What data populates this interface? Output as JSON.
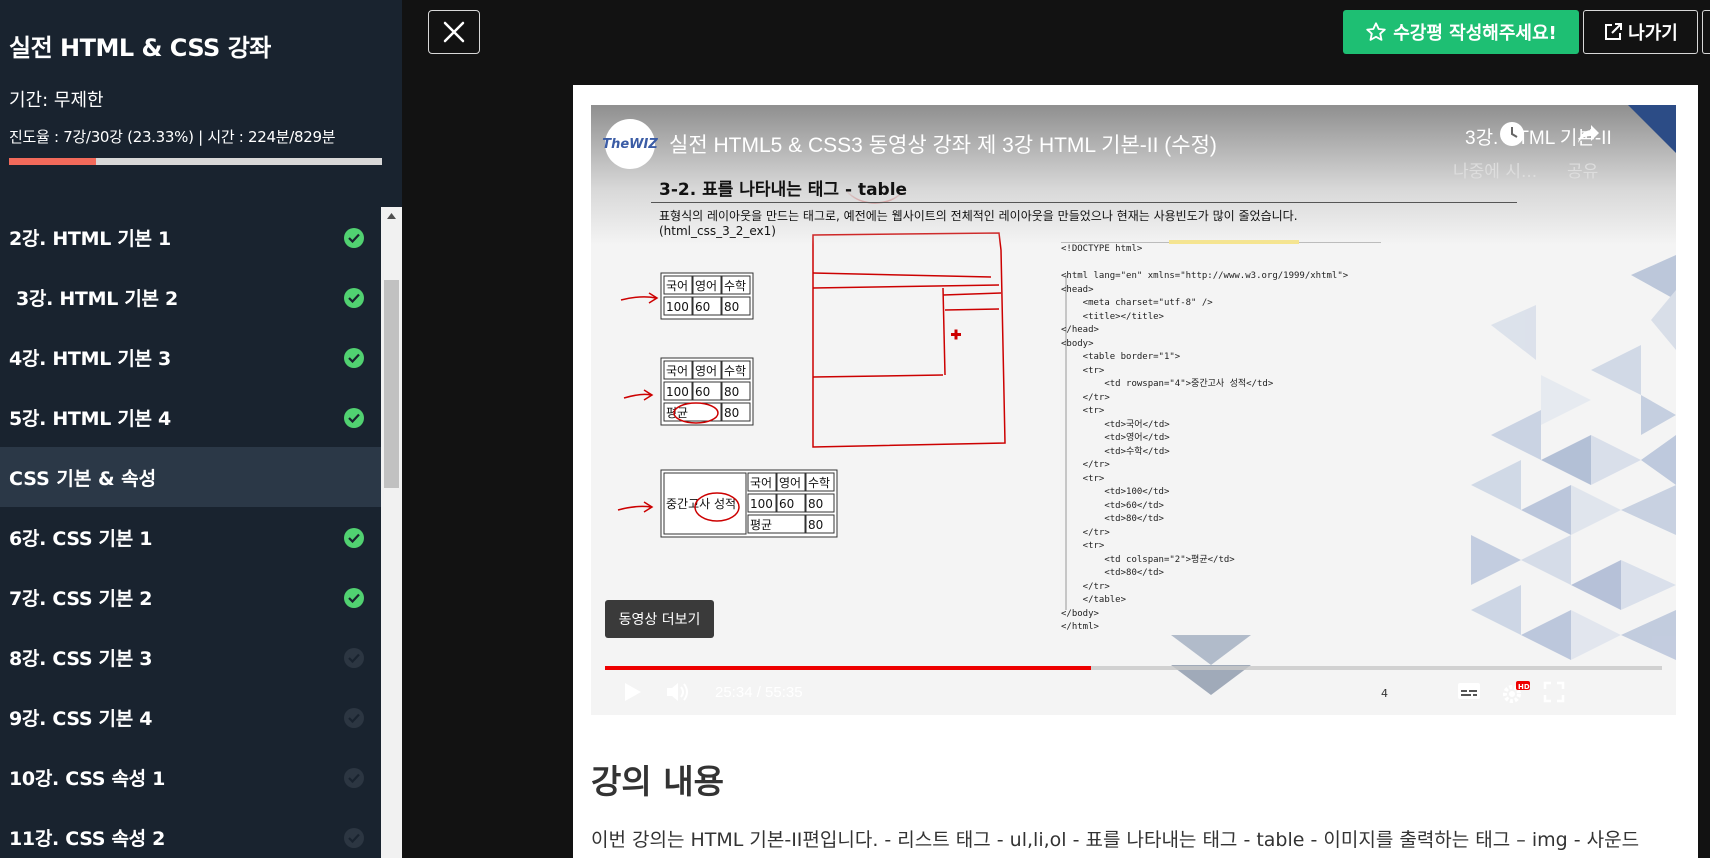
{
  "colors": {
    "sidebar_bg": "#19232f",
    "accent_green": "#1ebf73",
    "progress_fill": "#f26a5b",
    "check_done": "#51d171",
    "video_progress": "#e00000"
  },
  "sidebar": {
    "course_title": "실전 HTML & CSS 강좌",
    "period": "기간: 무제한",
    "progress_text": "진도율 : 7강/30강 (23.33%) | 시간 : 224분/829분",
    "progress_percent": 23.33,
    "items": [
      {
        "label": "2강. HTML 기본 1",
        "status": "done"
      },
      {
        "label": "3강. HTML 기본 2",
        "status": "done"
      },
      {
        "label": "4강. HTML 기본 3",
        "status": "done"
      },
      {
        "label": "5강. HTML 기본 4",
        "status": "done"
      },
      {
        "label": "CSS 기본 & 속성"
      },
      {
        "label": "6강. CSS 기본 1",
        "status": "done"
      },
      {
        "label": "7강. CSS 기본 2",
        "status": "done"
      },
      {
        "label": "8강. CSS 기본 3",
        "status": "todo"
      },
      {
        "label": "9강. CSS 기본 4",
        "status": "todo"
      },
      {
        "label": "10강. CSS 속성 1",
        "status": "todo"
      },
      {
        "label": "11강. CSS 속성 2",
        "status": "todo"
      }
    ]
  },
  "topbar": {
    "close_icon": "close-icon",
    "review_label": "수강평 작성해주세요!",
    "exit_label": "나가기"
  },
  "video": {
    "channel_logo": "TheWIZ",
    "title": "실전 HTML5 & CSS3 동영상 강좌 제 3강 HTML 기본-II (수정)",
    "side_title": "3강. HTML 기본-II",
    "watch_later": "나중에 시...",
    "share": "공유",
    "slide_heading": "3-2. 표를 나타내는 태그 - table",
    "slide_desc_1": "표형식의 레이아웃을 만드는 태그로, 예전에는 웹사이트의 전체적인 레이아웃을 만들었으나 현재는 사용빈도가 많이 줄었습니다.",
    "slide_desc_2": "(html_css_3_2_ex1)",
    "table_labels": {
      "kor": "국어",
      "eng": "영어",
      "math": "수학",
      "avg": "평균",
      "midterm": "중간고사 성적",
      "v100": "100",
      "v60": "60",
      "v80": "80"
    },
    "code_lines": [
      "<!DOCTYPE html>",
      "",
      "<html lang=\"en\" xmlns=\"http://www.w3.org/1999/xhtml\">",
      "<head>",
      "    <meta charset=\"utf-8\" />",
      "    <title></title>",
      "</head>",
      "<body>",
      "    <table border=\"1\">",
      "    <tr>",
      "        <td rowspan=\"4\">중간고사 성적</td>",
      "    </tr>",
      "    <tr>",
      "        <td>국어</td>",
      "        <td>영어</td>",
      "        <td>수학</td>",
      "    </tr>",
      "    <tr>",
      "        <td>100</td>",
      "        <td>60</td>",
      "        <td>80</td>",
      "    </tr>",
      "    <tr>",
      "        <td colspan=\"2\">평균</td>",
      "        <td>80</td>",
      "    </tr>",
      "    </table>",
      "</body>",
      "</html>"
    ],
    "more_videos": "동영상 더보기",
    "time": "25:34 / 55:35",
    "played_fraction": 0.46,
    "slide_number": "4",
    "hd_badge": "HD"
  },
  "lecture": {
    "section_title": "강의 내용",
    "body": "이번 강의는 HTML  기본-II편입니다. - 리스트 태그 - ul,li,ol - 표를 나타내는 태그 - table - 이미지를 출력하는 태그 – img - 사운드"
  }
}
